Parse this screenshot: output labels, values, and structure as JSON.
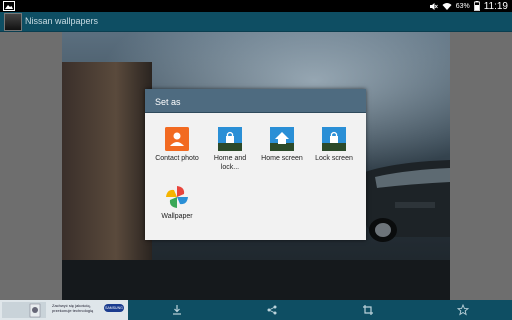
{
  "status_bar": {
    "battery_percent": "63%",
    "time": "11:19"
  },
  "action_bar": {
    "title": "Nissan wallpapers"
  },
  "dialog": {
    "title": "Set as",
    "options": [
      {
        "label": "Contact photo",
        "icon": "contact-photo-icon"
      },
      {
        "label": "Home and lock...",
        "icon": "home-and-lock-icon"
      },
      {
        "label": "Home screen",
        "icon": "home-screen-icon"
      },
      {
        "label": "Lock screen",
        "icon": "lock-screen-icon"
      },
      {
        "label": "Wallpaper",
        "icon": "wallpaper-pinwheel-icon"
      }
    ]
  },
  "bottom_bar": {
    "ad_text": "Zachwyć się jakością, przekonuje technologią",
    "ad_brand": "SAMSUNG",
    "actions": [
      "download-icon",
      "share-icon",
      "crop-icon",
      "favorite-star-icon"
    ]
  },
  "colors": {
    "action_bar": "#0e4e63",
    "dialog_header": "#4e6b80",
    "contact_orange": "#f26a21",
    "tile_blue": "#2a8fd6"
  }
}
